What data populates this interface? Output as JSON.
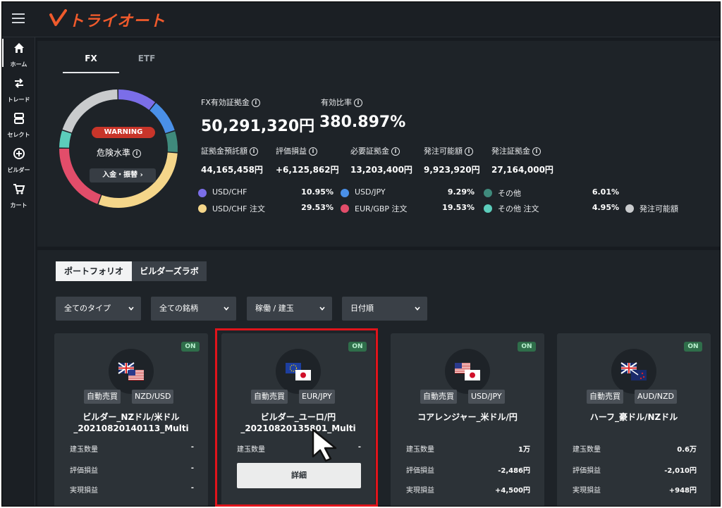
{
  "app": {
    "logo_text": "トライオート"
  },
  "nav": [
    {
      "label": "ホーム",
      "icon": "home-icon"
    },
    {
      "label": "トレード",
      "icon": "trade-arrows-icon"
    },
    {
      "label": "セレクト",
      "icon": "select-icon"
    },
    {
      "label": "ビルダー",
      "icon": "builder-plus-icon"
    },
    {
      "label": "カート",
      "icon": "cart-icon"
    }
  ],
  "tabs": {
    "fx": "FX",
    "etf": "ETF"
  },
  "summary": {
    "warning": "WARNING",
    "danger_label": "危険水準",
    "deposit_button": "入金・振替",
    "equity_label": "FX有効証拠金",
    "equity_value": "50,291,320円",
    "ratio_label": "有効比率",
    "ratio_value": "380.897%",
    "stats": [
      {
        "label": "証拠金預託額",
        "value": "44,165,458円"
      },
      {
        "label": "評価損益",
        "value": "+6,125,862円"
      },
      {
        "label": "必要証拠金",
        "value": "13,203,400円"
      },
      {
        "label": "発注可能額",
        "value": "9,923,920円"
      },
      {
        "label": "発注証拠金",
        "value": "27,164,000円"
      }
    ]
  },
  "allocation": {
    "colors": {
      "usdchf": "#7b6ee8",
      "usdjpy": "#4a90e8",
      "other": "#3f8a7c",
      "usdchf_order": "#f5d68a",
      "eurgbp_order": "#e24d6a",
      "other_order": "#5ccdbb",
      "available": "#c9cbcd"
    },
    "legend": [
      {
        "label": "USD/CHF",
        "pct": "10.95%"
      },
      {
        "label": "USD/JPY",
        "pct": "9.29%"
      },
      {
        "label": "その他",
        "pct": "6.01%"
      },
      {
        "label": "USD/CHF 注文",
        "pct": "29.53%"
      },
      {
        "label": "EUR/GBP 注文",
        "pct": "19.53%"
      },
      {
        "label": "その他 注文",
        "pct": "4.95%"
      },
      {
        "label": "発注可能額",
        "pct": ""
      }
    ],
    "shares": [
      {
        "key": "usdchf",
        "value": 10.95
      },
      {
        "key": "usdjpy",
        "value": 9.29
      },
      {
        "key": "other",
        "value": 6.01
      },
      {
        "key": "usdchf_order",
        "value": 29.53
      },
      {
        "key": "eurgbp_order",
        "value": 19.53
      },
      {
        "key": "other_order",
        "value": 4.95
      },
      {
        "key": "available",
        "value": 19.74
      }
    ]
  },
  "portfolio": {
    "tab_portfolio": "ポートフォリオ",
    "tab_labo": "ビルダーズラボ",
    "filters": [
      "全てのタイプ",
      "全ての銘柄",
      "稼働 / 建玉",
      "日付順"
    ],
    "row_labels": [
      "建玉数量",
      "評価損益",
      "実現損益"
    ],
    "on_label": "ON",
    "type_label": "自動売買",
    "detail_button": "詳細",
    "cards": [
      {
        "pair": "NZD/USD",
        "title1": "ビルダー_NZドル/米ドル",
        "title2": "_20210820140113_Multi",
        "qty": "-",
        "pl": "-",
        "realized": "-"
      },
      {
        "pair": "EUR/JPY",
        "title1": "ビルダー_ユーロ/円",
        "title2": "_20210820135801_Multi",
        "qty": "-",
        "pl": "",
        "realized": ""
      },
      {
        "pair": "USD/JPY",
        "title1": "コアレンジャー_米ドル/円",
        "title2": "",
        "qty": "1万",
        "pl": "-2,486円",
        "realized": "+4,500円"
      },
      {
        "pair": "AUD/NZD",
        "title1": "ハーフ_豪ドル/NZドル",
        "title2": "",
        "qty": "0.6万",
        "pl": "-2,010円",
        "realized": "+948円"
      }
    ]
  }
}
